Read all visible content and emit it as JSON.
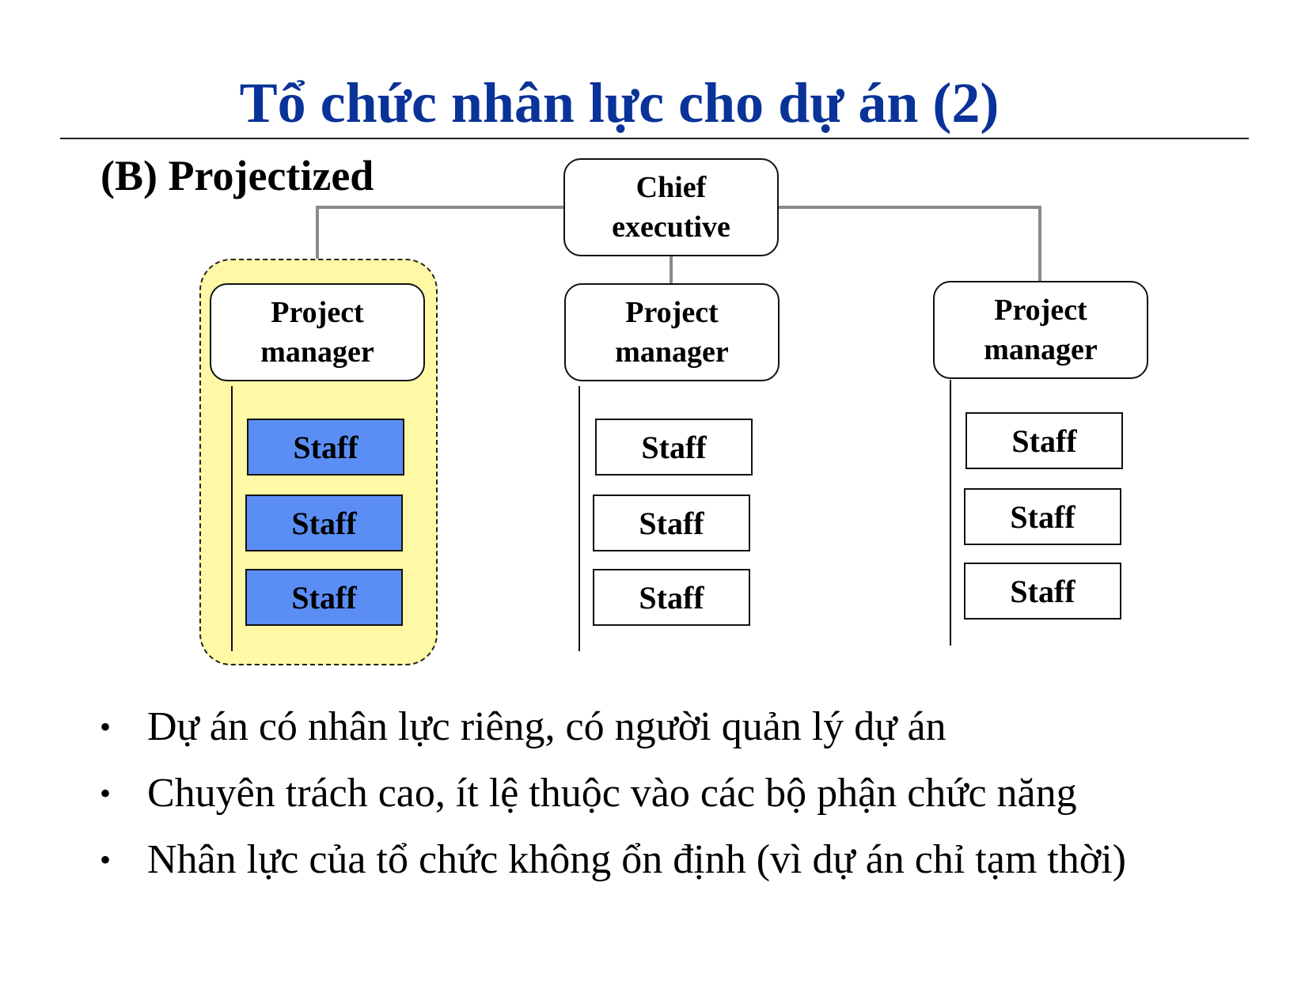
{
  "slide": {
    "title": "Tổ chức nhân lực cho dự án (2)",
    "subtitle": "(B) Projectized",
    "colors": {
      "title": "#0a3399",
      "highlight_fill": "#fff9a6",
      "staff_highlight": "#5b8ef5",
      "connector": "#8a8a8a"
    }
  },
  "org_chart": {
    "root": {
      "label": "Chief\nexecutive"
    },
    "projects": [
      {
        "manager": "Project\nmanager",
        "highlighted": true,
        "staff": [
          "Staff",
          "Staff",
          "Staff"
        ]
      },
      {
        "manager": "Project\nmanager",
        "highlighted": false,
        "staff": [
          "Staff",
          "Staff",
          "Staff"
        ]
      },
      {
        "manager": "Project\nmanager",
        "highlighted": false,
        "staff": [
          "Staff",
          "Staff",
          "Staff"
        ]
      }
    ]
  },
  "bullets": [
    "Dự án có nhân lực riêng, có người quản lý dự án",
    "Chuyên trách cao, ít lệ thuộc vào các bộ phận chức năng",
    "Nhân lực của tổ chức không ổn định (vì dự án chỉ tạm thời)"
  ],
  "bullet_glyph": "•"
}
